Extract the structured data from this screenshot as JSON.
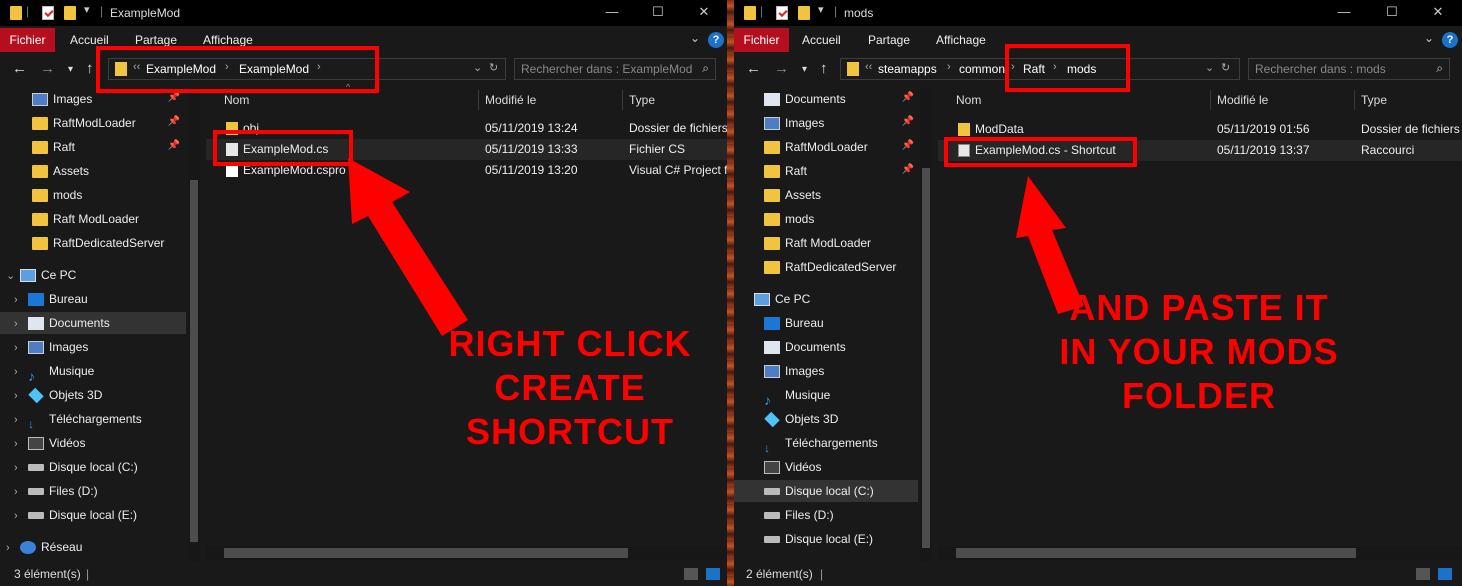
{
  "left": {
    "title": "ExampleMod",
    "tabs": {
      "file": "Fichier",
      "home": "Accueil",
      "share": "Partage",
      "view": "Affichage"
    },
    "address": [
      "ExampleMod",
      "ExampleMod"
    ],
    "search_placeholder": "Rechercher dans : ExampleMod",
    "nav_items": [
      {
        "label": "Images",
        "icon": "images-icon",
        "pinned": true
      },
      {
        "label": "RaftModLoader",
        "icon": "folder-icon",
        "pinned": true
      },
      {
        "label": "Raft",
        "icon": "folder-icon",
        "pinned": true
      },
      {
        "label": "Assets",
        "icon": "folder-icon"
      },
      {
        "label": "mods",
        "icon": "folder-icon"
      },
      {
        "label": "Raft ModLoader",
        "icon": "folder-icon"
      },
      {
        "label": "RaftDedicatedServer",
        "icon": "folder-icon"
      },
      {
        "label": "Ce PC",
        "icon": "computer-icon"
      },
      {
        "label": "Bureau",
        "icon": "desktop-icon"
      },
      {
        "label": "Documents",
        "icon": "documents-icon"
      },
      {
        "label": "Images",
        "icon": "images-icon"
      },
      {
        "label": "Musique",
        "icon": "music-icon"
      },
      {
        "label": "Objets 3D",
        "icon": "3d-objects-icon"
      },
      {
        "label": "Téléchargements",
        "icon": "downloads-icon"
      },
      {
        "label": "Vidéos",
        "icon": "videos-icon"
      },
      {
        "label": "Disque local (C:)",
        "icon": "drive-icon"
      },
      {
        "label": "Files (D:)",
        "icon": "drive-icon"
      },
      {
        "label": "Disque local (E:)",
        "icon": "drive-icon"
      },
      {
        "label": "Réseau",
        "icon": "network-icon"
      }
    ],
    "columns": {
      "name": "Nom",
      "modified": "Modifié le",
      "type": "Type"
    },
    "files": [
      {
        "name": "obj",
        "modified": "05/11/2019 13:24",
        "type": "Dossier de fichiers",
        "icon": "folder-icon"
      },
      {
        "name": "ExampleMod.cs",
        "modified": "05/11/2019 13:33",
        "type": "Fichier CS",
        "icon": "cs-file-icon"
      },
      {
        "name": "ExampleMod.cspro",
        "modified": "05/11/2019 13:20",
        "type": "Visual C# Project f...",
        "icon": "csproj-file-icon"
      }
    ],
    "status": "3 élément(s)",
    "annotation": [
      "RIGHT CLICK",
      "CREATE SHORTCUT"
    ]
  },
  "right": {
    "title": "mods",
    "tabs": {
      "file": "Fichier",
      "home": "Accueil",
      "share": "Partage",
      "view": "Affichage"
    },
    "address": [
      "steamapps",
      "common",
      "Raft",
      "mods"
    ],
    "search_placeholder": "Rechercher dans : mods",
    "nav_items": [
      {
        "label": "Documents",
        "icon": "documents-icon",
        "pinned": true
      },
      {
        "label": "Images",
        "icon": "images-icon",
        "pinned": true
      },
      {
        "label": "RaftModLoader",
        "icon": "folder-icon",
        "pinned": true
      },
      {
        "label": "Raft",
        "icon": "folder-icon",
        "pinned": true
      },
      {
        "label": "Assets",
        "icon": "folder-icon"
      },
      {
        "label": "mods",
        "icon": "folder-icon"
      },
      {
        "label": "Raft ModLoader",
        "icon": "folder-icon"
      },
      {
        "label": "RaftDedicatedServer",
        "icon": "folder-icon"
      },
      {
        "label": "Ce PC",
        "icon": "computer-icon"
      },
      {
        "label": "Bureau",
        "icon": "desktop-icon"
      },
      {
        "label": "Documents",
        "icon": "documents-icon"
      },
      {
        "label": "Images",
        "icon": "images-icon"
      },
      {
        "label": "Musique",
        "icon": "music-icon"
      },
      {
        "label": "Objets 3D",
        "icon": "3d-objects-icon"
      },
      {
        "label": "Téléchargements",
        "icon": "downloads-icon"
      },
      {
        "label": "Vidéos",
        "icon": "videos-icon"
      },
      {
        "label": "Disque local (C:)",
        "icon": "drive-icon"
      },
      {
        "label": "Files (D:)",
        "icon": "drive-icon"
      },
      {
        "label": "Disque local (E:)",
        "icon": "drive-icon"
      }
    ],
    "columns": {
      "name": "Nom",
      "modified": "Modifié le",
      "type": "Type"
    },
    "files": [
      {
        "name": "ModData",
        "modified": "05/11/2019 01:56",
        "type": "Dossier de fichiers",
        "icon": "folder-icon"
      },
      {
        "name": "ExampleMod.cs - Shortcut",
        "modified": "05/11/2019 13:37",
        "type": "Raccourci",
        "icon": "shortcut-icon"
      }
    ],
    "status": "2 élément(s)",
    "annotation": [
      "AND PASTE IT",
      "IN YOUR MODS FOLDER"
    ]
  },
  "colors": {
    "accent_red": "#ff0000",
    "file_tab": "#b50e1e",
    "folder": "#f1c43f",
    "window_bg": "#191919"
  }
}
